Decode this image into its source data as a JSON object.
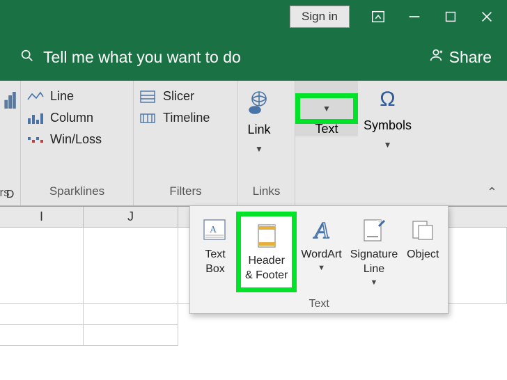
{
  "titlebar": {
    "signin": "Sign in"
  },
  "tellme": {
    "placeholder": "Tell me what you want to do",
    "share": "Share"
  },
  "ribbon": {
    "partial_left_bottom": "D",
    "sparklines": {
      "line": "Line",
      "column": "Column",
      "winloss": "Win/Loss",
      "label": "Sparklines"
    },
    "filters": {
      "slicer": "Slicer",
      "timeline": "Timeline",
      "label": "Filters"
    },
    "links": {
      "link": "Link",
      "label": "Links"
    },
    "text": {
      "text": "Text"
    },
    "symbols": {
      "symbols": "Symbols"
    },
    "partial_right_label": "urs"
  },
  "popup": {
    "textbox": "Text\nBox",
    "headerfooter": "Header\n& Footer",
    "wordart": "WordArt",
    "sigline": "Signature\nLine",
    "object": "Object",
    "label": "Text"
  },
  "columns": {
    "I": "I",
    "J": "J"
  }
}
